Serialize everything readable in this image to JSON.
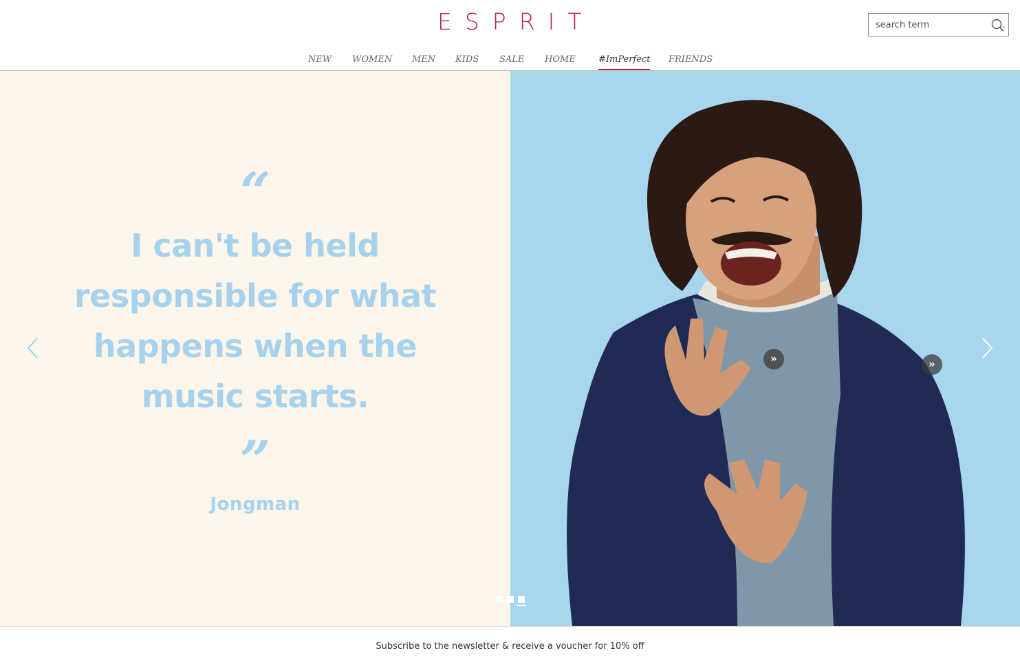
{
  "header": {
    "logo": "ESPRIT",
    "brand_color": "#b8233d",
    "search": {
      "placeholder": "search term",
      "icon": "search-icon"
    }
  },
  "nav": {
    "items": [
      {
        "label": "NEW"
      },
      {
        "label": "WOMEN"
      },
      {
        "label": "MEN"
      },
      {
        "label": "KIDS"
      },
      {
        "label": "SALE"
      },
      {
        "label": "HOME"
      },
      {
        "label": "#ImPerfect",
        "active": true
      },
      {
        "label": "FRIENDS"
      }
    ]
  },
  "hero": {
    "quote_open": "“",
    "quote": "I can't be held responsible for what happens when the music starts.",
    "quote_close": "”",
    "author": "Jongman",
    "quote_color": "#a7d2ee",
    "panel_color": "#fcf5ea",
    "photo_bg_color": "#a9d6ef",
    "prev_icon": "chevron-left-icon",
    "next_icon": "chevron-right-icon",
    "hotspot_label": "»",
    "slides_total": 3,
    "active_slide": 3
  },
  "footer": {
    "newsletter": "Subscribe to the newsletter & receive a voucher for 10% off"
  }
}
